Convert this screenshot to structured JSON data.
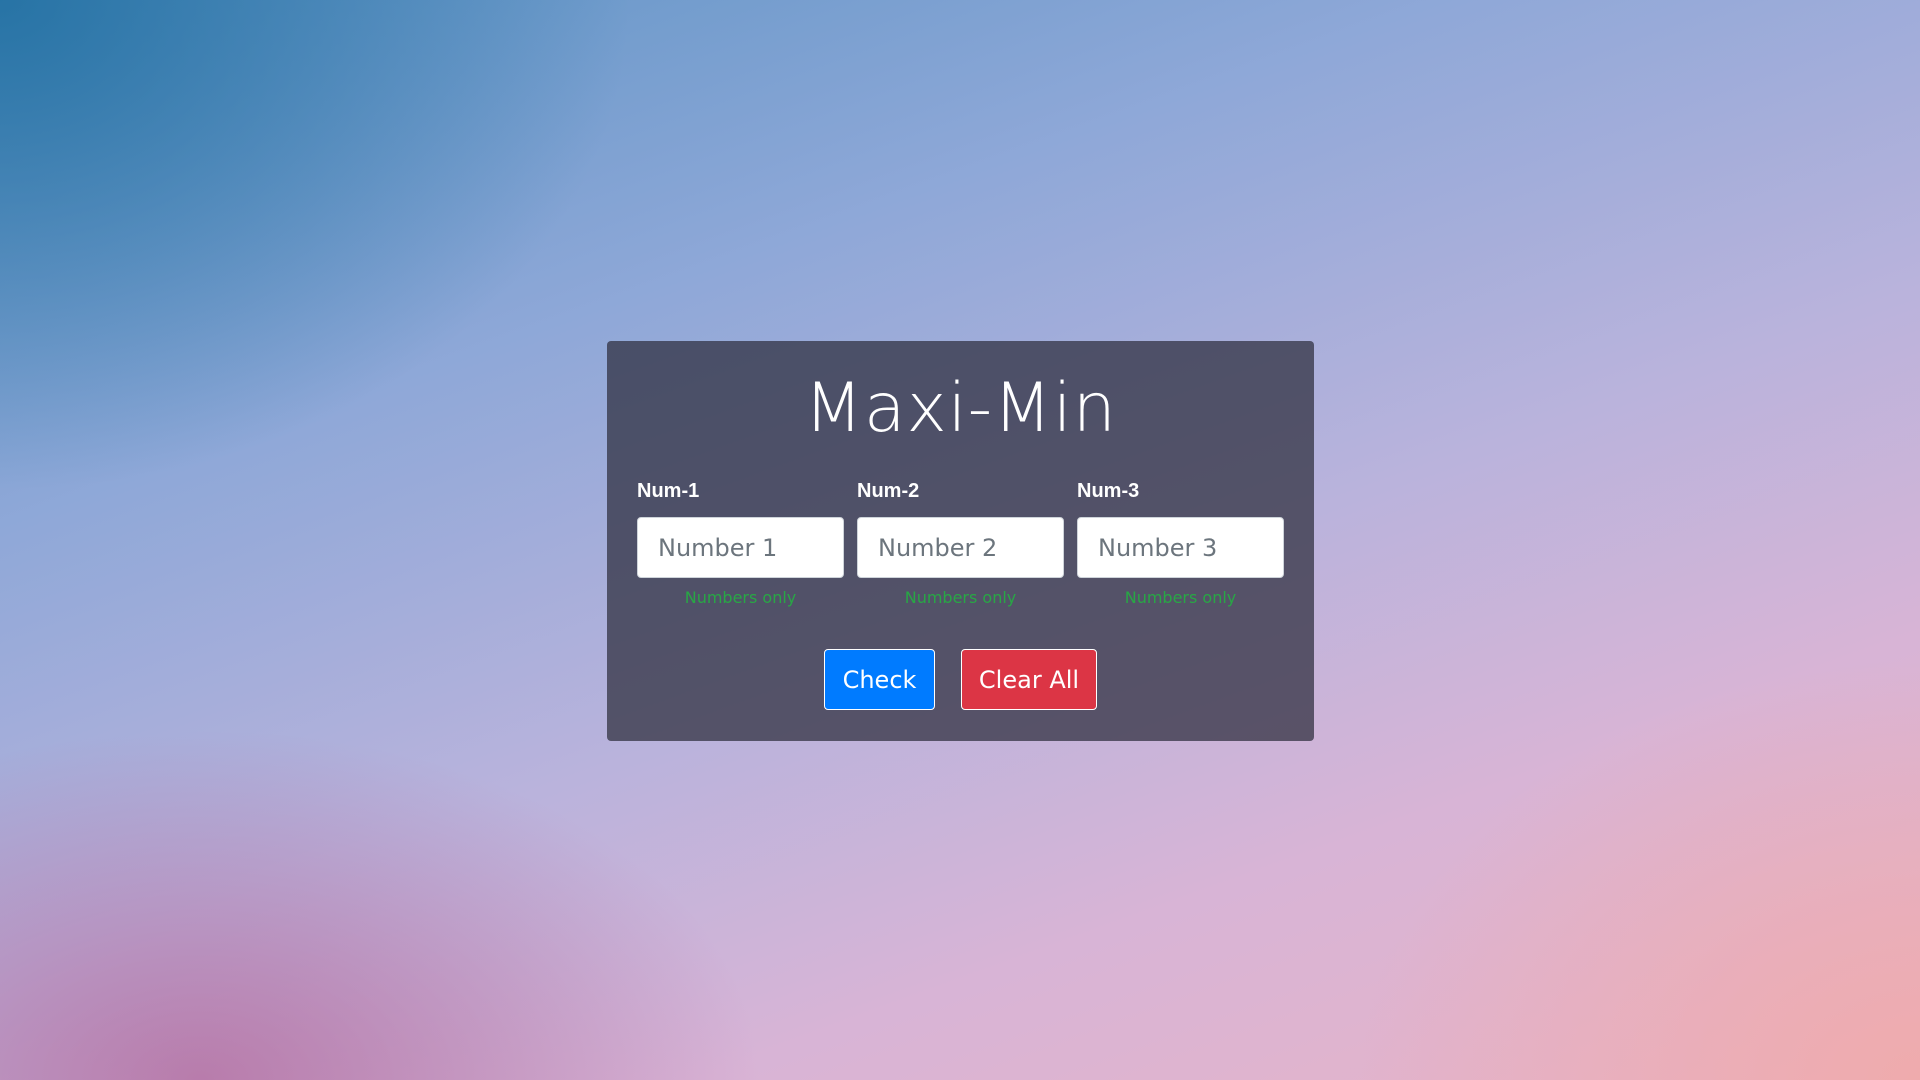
{
  "app": {
    "title": "Maxi-Min"
  },
  "fields": [
    {
      "label": "Num-1",
      "placeholder": "Number 1",
      "value": "",
      "hint": "Numbers only"
    },
    {
      "label": "Num-2",
      "placeholder": "Number 2",
      "value": "",
      "hint": "Numbers only"
    },
    {
      "label": "Num-3",
      "placeholder": "Number 3",
      "value": "",
      "hint": "Numbers only"
    }
  ],
  "buttons": {
    "check_label": "Check",
    "clear_label": "Clear All"
  },
  "colors": {
    "primary": "#007bff",
    "danger": "#dc3545",
    "hint": "#28a745"
  }
}
